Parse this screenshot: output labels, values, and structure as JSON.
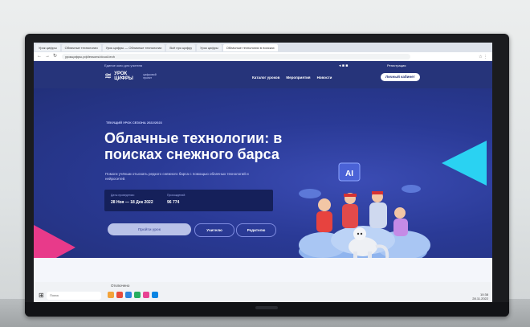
{
  "browser": {
    "tabs": [
      "Урок цифры",
      "Облачные технологии",
      "Урок цифры — Облачные технологии",
      "Всё про цифру",
      "Урок цифры",
      "Облачные технологии в поисках"
    ],
    "url": "урокцифры.рф/lessons/cloud-tech"
  },
  "site": {
    "topline": "Единое окно для учителя",
    "logo_text": "УРОК ЦИФРЫ",
    "logo_sub": "цифровой проект",
    "menu": [
      "Каталог уроков",
      "Мероприятия",
      "Новости"
    ],
    "account_label": "Личный кабинет",
    "header_link": "Регистрация"
  },
  "hero": {
    "kicker": "ТЕКУЩИЙ УРОК СЕЗОНА 2022/2023",
    "title": "Облачные технологии: в поисках снежного барса",
    "description": "Помоги учёным отыскать редкого снежного барса с помощью облачных технологий и нейросетей.",
    "dates_label": "Даты проведения:",
    "dates_value": "28 Ноя — 18 Дек 2022",
    "progress_label": "Прохождений:",
    "progress_value": "96 774",
    "primary_button": "Пройти урок",
    "teachers_button": "Учителю",
    "parents_button": "Родителю",
    "ai_label": "AI"
  },
  "taskbar": {
    "notice": "Отключено",
    "search_placeholder": "Поиск",
    "clock": "10:38",
    "date": "28.11.2022"
  },
  "colors": {
    "hero_bg": "#2a3a96",
    "cyan_accent": "#2ad2f2",
    "pink_accent": "#e83a8a"
  }
}
